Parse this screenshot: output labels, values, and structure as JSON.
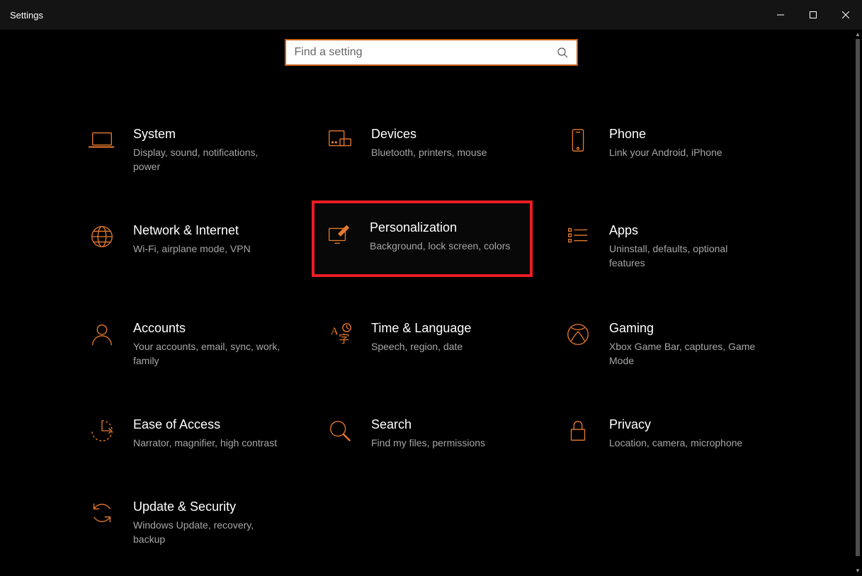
{
  "window": {
    "title": "Settings"
  },
  "search": {
    "placeholder": "Find a setting"
  },
  "tiles": {
    "system": {
      "title": "System",
      "desc": "Display, sound, notifications, power"
    },
    "devices": {
      "title": "Devices",
      "desc": "Bluetooth, printers, mouse"
    },
    "phone": {
      "title": "Phone",
      "desc": "Link your Android, iPhone"
    },
    "network": {
      "title": "Network & Internet",
      "desc": "Wi-Fi, airplane mode, VPN"
    },
    "personalization": {
      "title": "Personalization",
      "desc": "Background, lock screen, colors"
    },
    "apps": {
      "title": "Apps",
      "desc": "Uninstall, defaults, optional features"
    },
    "accounts": {
      "title": "Accounts",
      "desc": "Your accounts, email, sync, work, family"
    },
    "time": {
      "title": "Time & Language",
      "desc": "Speech, region, date"
    },
    "gaming": {
      "title": "Gaming",
      "desc": "Xbox Game Bar, captures, Game Mode"
    },
    "ease": {
      "title": "Ease of Access",
      "desc": "Narrator, magnifier, high contrast"
    },
    "search_cat": {
      "title": "Search",
      "desc": "Find my files, permissions"
    },
    "privacy": {
      "title": "Privacy",
      "desc": "Location, camera, microphone"
    },
    "update": {
      "title": "Update & Security",
      "desc": "Windows Update, recovery, backup"
    }
  },
  "accent": "#e77a2c",
  "highlight_border": "#ec1c24"
}
